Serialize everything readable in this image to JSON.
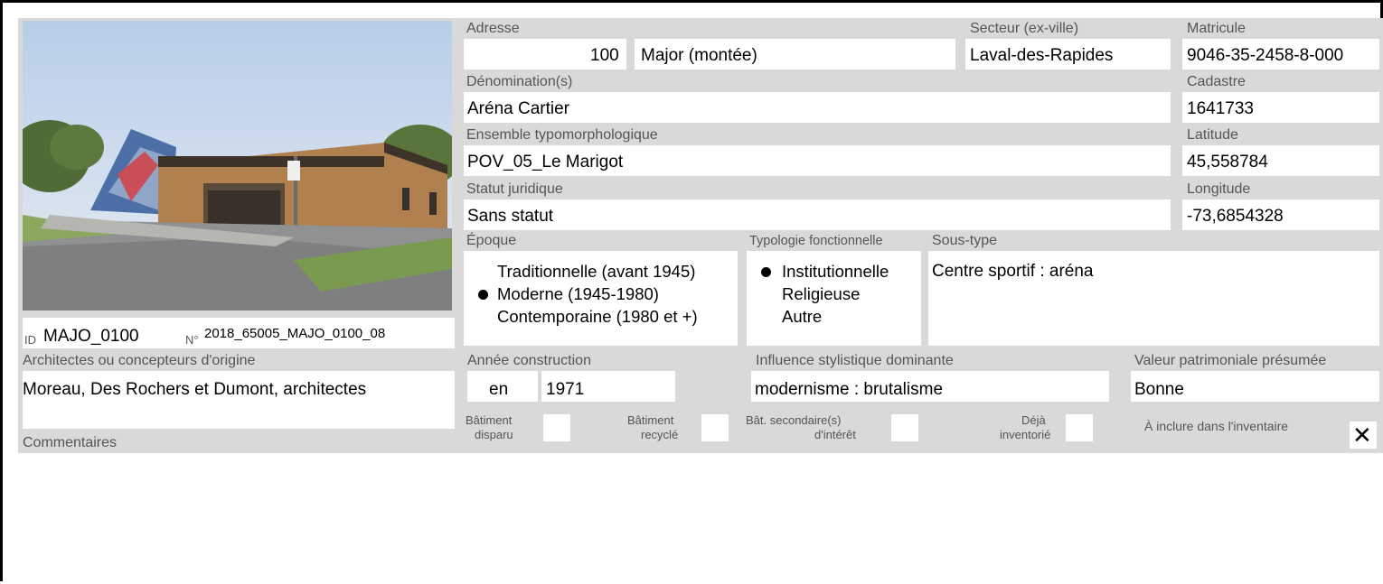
{
  "photo": {
    "alt": "Aréna Cartier building photo"
  },
  "id_label": "ID",
  "id_value": "MAJO_0100",
  "no_label": "N°",
  "no_value": "2018_65005_MAJO_0100_08",
  "adresse": {
    "label": "Adresse",
    "number": "100",
    "street": "Major (montée)"
  },
  "secteur": {
    "label": "Secteur (ex-ville)",
    "value": "Laval-des-Rapides"
  },
  "matricule": {
    "label": "Matricule",
    "value": "9046-35-2458-8-000"
  },
  "denomination": {
    "label": "Dénomination(s)",
    "value": "Aréna Cartier"
  },
  "cadastre": {
    "label": "Cadastre",
    "value": "1641733"
  },
  "ensemble": {
    "label": "Ensemble typomorphologique",
    "value": "POV_05_Le Marigot"
  },
  "latitude": {
    "label": "Latitude",
    "value": "45,558784"
  },
  "statut": {
    "label": "Statut juridique",
    "value": "Sans statut"
  },
  "longitude": {
    "label": "Longitude",
    "value": "-73,6854328"
  },
  "epoque": {
    "label": "Époque",
    "options": [
      "Traditionnelle (avant 1945)",
      "Moderne (1945-1980)",
      "Contemporaine (1980 et +)"
    ],
    "selected": "Moderne (1945-1980)"
  },
  "typologie": {
    "label": "Typologie fonctionnelle",
    "options": [
      "Institutionnelle",
      "Religieuse",
      "Autre"
    ],
    "selected": "Institutionnelle"
  },
  "soustype": {
    "label": "Sous-type",
    "value": "Centre sportif : aréna"
  },
  "architectes": {
    "label": "Architectes ou concepteurs d'origine",
    "value": "Moreau, Des Rochers et Dumont, architectes"
  },
  "annee": {
    "label": "Année construction",
    "prefix": "en",
    "value": "1971"
  },
  "influence": {
    "label": "Influence stylistique dominante",
    "value": "modernisme : brutalisme"
  },
  "valeur": {
    "label": "Valeur patrimoniale présumée",
    "value": "Bonne"
  },
  "checkboxes": {
    "disparu": {
      "line1": "Bâtiment",
      "line2": "disparu",
      "checked": false
    },
    "recycle": {
      "line1": "Bâtiment",
      "line2": "recyclé",
      "checked": false
    },
    "secondaire": {
      "line1": "Bât. secondaire(s)",
      "line2": "d'intérêt",
      "checked": false
    },
    "inventorie": {
      "line1": "Déjà",
      "line2": "inventorié",
      "checked": false
    },
    "inclure": {
      "label": "À inclure dans l'inventaire",
      "checked": true,
      "mark": "✕"
    }
  },
  "commentaires": {
    "label": "Commentaires",
    "value": ""
  }
}
